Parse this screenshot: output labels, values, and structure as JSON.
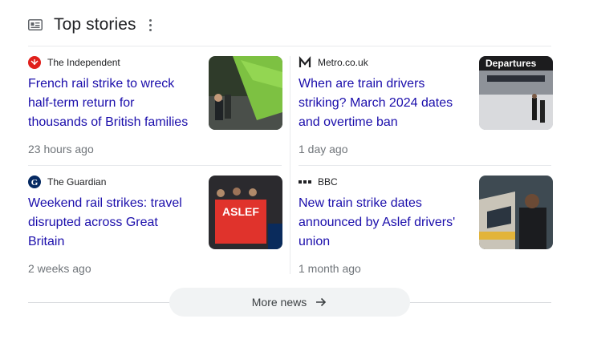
{
  "section": {
    "title": "Top stories"
  },
  "stories": [
    {
      "source": "The Independent",
      "headline": "French rail strike to wreck half-term return for thousands of British families",
      "time": "23 hours ago"
    },
    {
      "source": "Metro.co.uk",
      "headline": "When are train drivers striking? March 2024 dates and overtime ban",
      "time": "1 day ago",
      "thumb_text": "Departures"
    },
    {
      "source": "The Guardian",
      "headline": "Weekend rail strikes: travel disrupted across Great Britain",
      "time": "2 weeks ago",
      "thumb_text": "ASLEF"
    },
    {
      "source": "BBC",
      "headline": "New train strike dates announced by Aslef drivers' union",
      "time": "1 month ago"
    }
  ],
  "more_news": {
    "label": "More news"
  },
  "colors": {
    "link": "#1a0dab",
    "secondary": "#70757a",
    "button_bg": "#f1f3f4"
  }
}
